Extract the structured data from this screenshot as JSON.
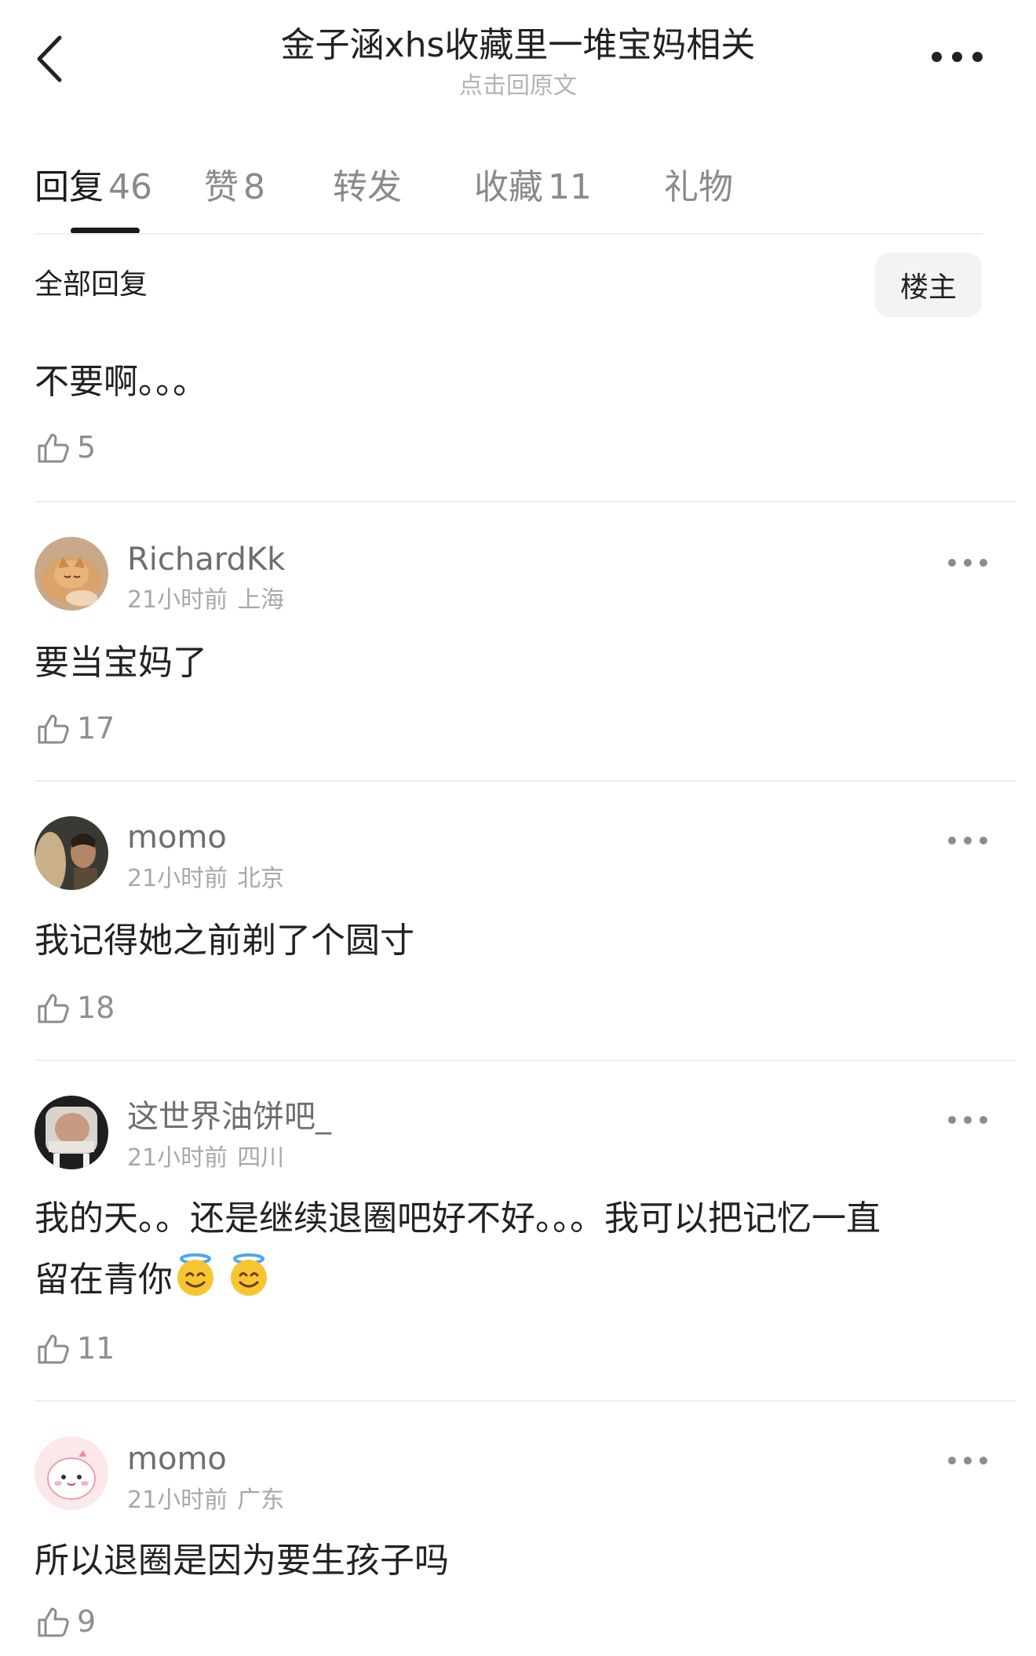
{
  "header": {
    "title": "金子涵xhs收藏里一堆宝妈相关",
    "subtitle": "点击回原文",
    "back_icon": "chevron-left-icon",
    "more_icon": "more-horizontal-icon"
  },
  "tabs": [
    {
      "label": "回复",
      "count": "46",
      "active": true
    },
    {
      "label": "赞",
      "count": "8",
      "active": false
    },
    {
      "label": "转发",
      "count": "",
      "active": false
    },
    {
      "label": "收藏",
      "count": "11",
      "active": false
    },
    {
      "label": "礼物",
      "count": "",
      "active": false
    }
  ],
  "filter": {
    "all_replies_label": "全部回复",
    "host_only_label": "楼主"
  },
  "post": {
    "text": "不要啊。。。",
    "likes": "5"
  },
  "comments": [
    {
      "username": "RichardKk",
      "time": "21小时前",
      "location": "上海",
      "text": "要当宝妈了",
      "likes": "17",
      "avatar": "cat-avatar"
    },
    {
      "username": "momo",
      "time": "21小时前",
      "location": "北京",
      "text": "我记得她之前剃了个圆寸",
      "likes": "18",
      "avatar": "portrait-avatar"
    },
    {
      "username": "这世界油饼吧_",
      "time": "21小时前",
      "location": "四川",
      "text_line1": "我的天。。还是继续退圈吧好不好。。。我可以把记忆一直",
      "text_line2": "留在青你",
      "emoji": "smiling-face-with-halo-icon",
      "likes": "11",
      "avatar": "selfie-avatar"
    },
    {
      "username": "momo",
      "time": "21小时前",
      "location": "广东",
      "text": "所以退圈是因为要生孩子吗",
      "likes": "9",
      "avatar": "cartoon-avatar"
    }
  ],
  "colors": {
    "text_primary": "#222222",
    "text_secondary": "#8a8a8a",
    "divider": "#eeeeee",
    "host_button_bg": "#f3f3f3"
  }
}
